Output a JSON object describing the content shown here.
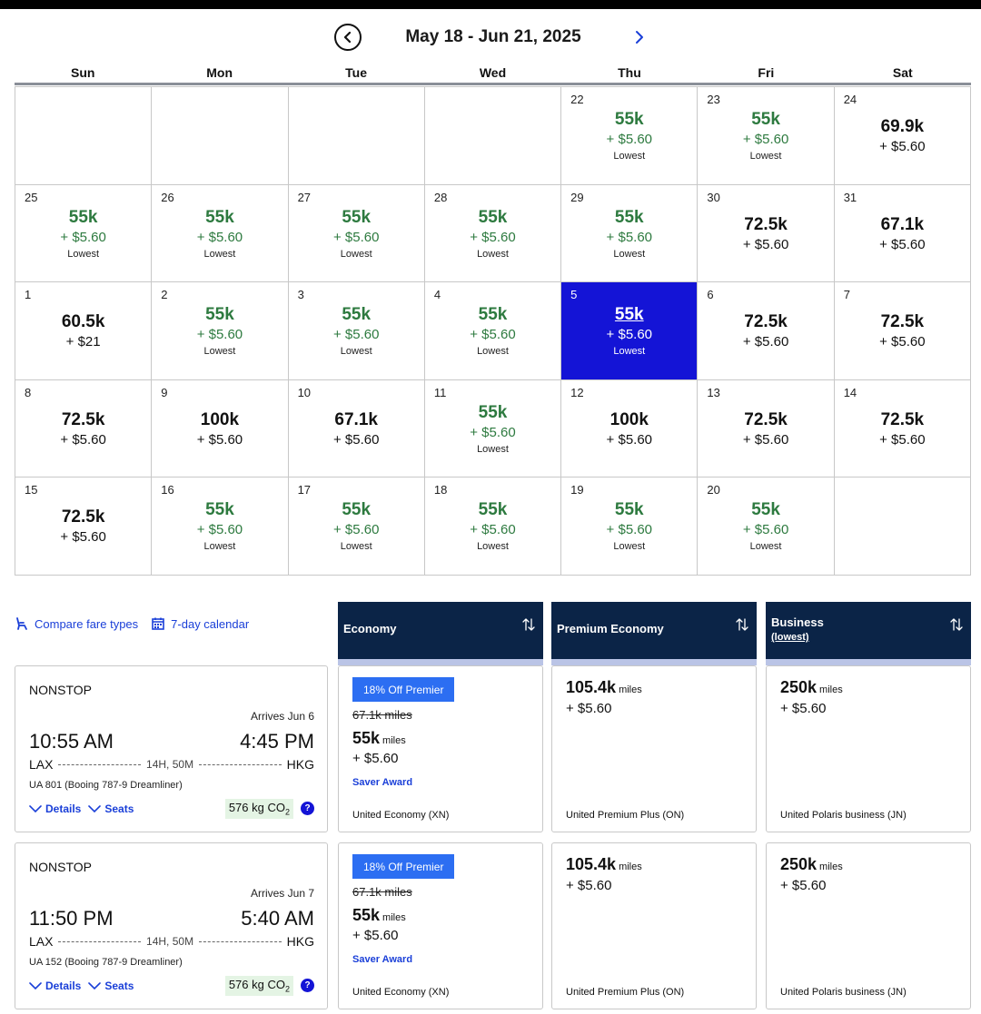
{
  "calendar": {
    "range_label": "May 18 - Jun 21, 2025",
    "weekdays": [
      "Sun",
      "Mon",
      "Tue",
      "Wed",
      "Thu",
      "Fri",
      "Sat"
    ],
    "lowest_label": "Lowest",
    "cells": [
      {
        "day": "",
        "miles": "",
        "fee": "",
        "lowest": false,
        "selected": false
      },
      {
        "day": "",
        "miles": "",
        "fee": "",
        "lowest": false,
        "selected": false
      },
      {
        "day": "",
        "miles": "",
        "fee": "",
        "lowest": false,
        "selected": false
      },
      {
        "day": "",
        "miles": "",
        "fee": "",
        "lowest": false,
        "selected": false
      },
      {
        "day": "22",
        "miles": "55k",
        "fee": "+ $5.60",
        "lowest": true,
        "selected": false
      },
      {
        "day": "23",
        "miles": "55k",
        "fee": "+ $5.60",
        "lowest": true,
        "selected": false
      },
      {
        "day": "24",
        "miles": "69.9k",
        "fee": "+ $5.60",
        "lowest": false,
        "selected": false
      },
      {
        "day": "25",
        "miles": "55k",
        "fee": "+ $5.60",
        "lowest": true,
        "selected": false
      },
      {
        "day": "26",
        "miles": "55k",
        "fee": "+ $5.60",
        "lowest": true,
        "selected": false
      },
      {
        "day": "27",
        "miles": "55k",
        "fee": "+ $5.60",
        "lowest": true,
        "selected": false
      },
      {
        "day": "28",
        "miles": "55k",
        "fee": "+ $5.60",
        "lowest": true,
        "selected": false
      },
      {
        "day": "29",
        "miles": "55k",
        "fee": "+ $5.60",
        "lowest": true,
        "selected": false
      },
      {
        "day": "30",
        "miles": "72.5k",
        "fee": "+ $5.60",
        "lowest": false,
        "selected": false
      },
      {
        "day": "31",
        "miles": "67.1k",
        "fee": "+ $5.60",
        "lowest": false,
        "selected": false
      },
      {
        "day": "1",
        "miles": "60.5k",
        "fee": "+ $21",
        "lowest": false,
        "selected": false
      },
      {
        "day": "2",
        "miles": "55k",
        "fee": "+ $5.60",
        "lowest": true,
        "selected": false
      },
      {
        "day": "3",
        "miles": "55k",
        "fee": "+ $5.60",
        "lowest": true,
        "selected": false
      },
      {
        "day": "4",
        "miles": "55k",
        "fee": "+ $5.60",
        "lowest": true,
        "selected": false
      },
      {
        "day": "5",
        "miles": "55k",
        "fee": "+ $5.60",
        "lowest": true,
        "selected": true
      },
      {
        "day": "6",
        "miles": "72.5k",
        "fee": "+ $5.60",
        "lowest": false,
        "selected": false
      },
      {
        "day": "7",
        "miles": "72.5k",
        "fee": "+ $5.60",
        "lowest": false,
        "selected": false
      },
      {
        "day": "8",
        "miles": "72.5k",
        "fee": "+ $5.60",
        "lowest": false,
        "selected": false
      },
      {
        "day": "9",
        "miles": "100k",
        "fee": "+ $5.60",
        "lowest": false,
        "selected": false
      },
      {
        "day": "10",
        "miles": "67.1k",
        "fee": "+ $5.60",
        "lowest": false,
        "selected": false
      },
      {
        "day": "11",
        "miles": "55k",
        "fee": "+ $5.60",
        "lowest": true,
        "selected": false
      },
      {
        "day": "12",
        "miles": "100k",
        "fee": "+ $5.60",
        "lowest": false,
        "selected": false
      },
      {
        "day": "13",
        "miles": "72.5k",
        "fee": "+ $5.60",
        "lowest": false,
        "selected": false
      },
      {
        "day": "14",
        "miles": "72.5k",
        "fee": "+ $5.60",
        "lowest": false,
        "selected": false
      },
      {
        "day": "15",
        "miles": "72.5k",
        "fee": "+ $5.60",
        "lowest": false,
        "selected": false
      },
      {
        "day": "16",
        "miles": "55k",
        "fee": "+ $5.60",
        "lowest": true,
        "selected": false
      },
      {
        "day": "17",
        "miles": "55k",
        "fee": "+ $5.60",
        "lowest": true,
        "selected": false
      },
      {
        "day": "18",
        "miles": "55k",
        "fee": "+ $5.60",
        "lowest": true,
        "selected": false
      },
      {
        "day": "19",
        "miles": "55k",
        "fee": "+ $5.60",
        "lowest": true,
        "selected": false
      },
      {
        "day": "20",
        "miles": "55k",
        "fee": "+ $5.60",
        "lowest": true,
        "selected": false
      },
      {
        "day": "",
        "miles": "",
        "fee": "",
        "lowest": false,
        "selected": false
      }
    ]
  },
  "links": {
    "compare": "Compare fare types",
    "seven_day": "7-day calendar"
  },
  "fare_headers": {
    "economy": "Economy",
    "premium": "Premium Economy",
    "business": "Business",
    "business_sub": "(lowest)"
  },
  "flights": [
    {
      "stops": "NONSTOP",
      "arrives": "Arrives Jun 6",
      "depart_time": "10:55 AM",
      "arrive_time": "4:45 PM",
      "origin": "LAX",
      "duration": "14H, 50M",
      "destination": "HKG",
      "aircraft": "UA 801 (Booing 787-9 Dreamliner)",
      "details": "Details",
      "seats": "Seats",
      "co2_value": "576 kg CO",
      "co2_sub": "2",
      "info": "?",
      "economy": {
        "promo": "18% Off Premier",
        "original": "67.1k miles",
        "miles": "55k",
        "unit": "miles",
        "fee": "+ $5.60",
        "award": "Saver Award",
        "fare_name": "United Economy (XN)"
      },
      "premium": {
        "miles": "105.4k",
        "unit": "miles",
        "fee": "+ $5.60",
        "fare_name": "United Premium Plus (ON)"
      },
      "business": {
        "miles": "250k",
        "unit": "miles",
        "fee": "+ $5.60",
        "fare_name": "United Polaris business (JN)"
      }
    },
    {
      "stops": "NONSTOP",
      "arrives": "Arrives Jun 7",
      "depart_time": "11:50 PM",
      "arrive_time": "5:40 AM",
      "origin": "LAX",
      "duration": "14H, 50M",
      "destination": "HKG",
      "aircraft": "UA 152 (Booing 787-9 Dreamliner)",
      "details": "Details",
      "seats": "Seats",
      "co2_value": "576 kg CO",
      "co2_sub": "2",
      "info": "?",
      "economy": {
        "promo": "18% Off Premier",
        "original": "67.1k miles",
        "miles": "55k",
        "unit": "miles",
        "fee": "+ $5.60",
        "award": "Saver Award",
        "fare_name": "United Economy (XN)"
      },
      "premium": {
        "miles": "105.4k",
        "unit": "miles",
        "fee": "+ $5.60",
        "fare_name": "United Premium Plus (ON)"
      },
      "business": {
        "miles": "250k",
        "unit": "miles",
        "fee": "+ $5.60",
        "fare_name": "United Polaris business (JN)"
      }
    }
  ],
  "colors": {
    "lowest_green": "#2d7a3f",
    "selected_blue": "#1414d6",
    "header_navy": "#0b2447",
    "link_blue": "#1a3fd8",
    "promo_blue": "#2c6ef2"
  },
  "icons": {
    "prev": "chevron-left-circle-icon",
    "next": "chevron-right-icon",
    "compare": "seat-icon",
    "calendar": "calendar-icon",
    "sort": "sort-arrows-icon",
    "expand": "chevron-down-icon",
    "info": "info-icon"
  }
}
